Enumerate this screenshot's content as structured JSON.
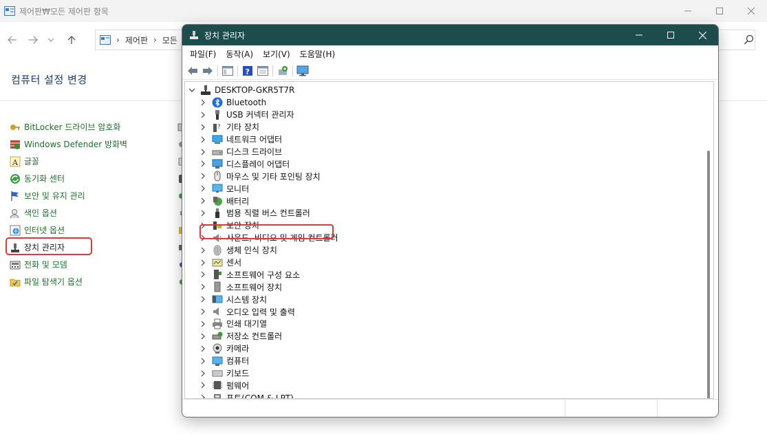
{
  "control_panel": {
    "window_title": "제어판₩모든 제어판 항목",
    "address": {
      "crumbs": [
        "제어판",
        "모든"
      ]
    },
    "heading": "컴퓨터 설정 변경",
    "items": [
      {
        "label": "BitLocker 드라이브 암호화",
        "icon": "bitlocker-icon"
      },
      {
        "label": "Windows Defender 방화벽",
        "icon": "firewall-icon"
      },
      {
        "label": "글꼴",
        "icon": "font-icon"
      },
      {
        "label": "동기화 센터",
        "icon": "sync-icon"
      },
      {
        "label": "보안 및 유지 관리",
        "icon": "flag-icon"
      },
      {
        "label": "색인 옵션",
        "icon": "index-icon"
      },
      {
        "label": "인터넷 옵션",
        "icon": "internet-icon"
      },
      {
        "label": "장치 관리자",
        "icon": "device-manager-icon"
      },
      {
        "label": "전화 및 모뎀",
        "icon": "phone-icon"
      },
      {
        "label": "파일 탐색기 옵션",
        "icon": "folder-icon"
      }
    ]
  },
  "device_manager": {
    "window_title": "장치 관리자",
    "menus": [
      "파일(F)",
      "동작(A)",
      "보기(V)",
      "도움말(H)"
    ],
    "root": "DESKTOP-GKR5T7R",
    "devices": [
      {
        "label": "Bluetooth",
        "icon": "bluetooth-icon"
      },
      {
        "label": "USB 커넥터 관리자",
        "icon": "usb-icon"
      },
      {
        "label": "기타 장치",
        "icon": "unknown-device-icon"
      },
      {
        "label": "네트워크 어댑터",
        "icon": "network-icon"
      },
      {
        "label": "디스크 드라이브",
        "icon": "disk-icon"
      },
      {
        "label": "디스플레이 어댑터",
        "icon": "display-adapter-icon"
      },
      {
        "label": "마우스 및 기타 포인팅 장치",
        "icon": "mouse-icon"
      },
      {
        "label": "모니터",
        "icon": "monitor-icon"
      },
      {
        "label": "배터리",
        "icon": "battery-icon"
      },
      {
        "label": "범용 직렬 버스 컨트롤러",
        "icon": "usb-controller-icon"
      },
      {
        "label": "보안 장치",
        "icon": "security-device-icon"
      },
      {
        "label": "사운드, 비디오 및 게임 컨트롤러",
        "icon": "sound-icon"
      },
      {
        "label": "생체 인식 장치",
        "icon": "biometric-icon"
      },
      {
        "label": "센서",
        "icon": "sensor-icon"
      },
      {
        "label": "소프트웨어 구성 요소",
        "icon": "software-component-icon"
      },
      {
        "label": "소프트웨어 장치",
        "icon": "software-device-icon"
      },
      {
        "label": "시스템 장치",
        "icon": "system-device-icon"
      },
      {
        "label": "오디오 입력 및 출력",
        "icon": "audio-io-icon"
      },
      {
        "label": "인쇄 대기열",
        "icon": "printer-icon"
      },
      {
        "label": "저장소 컨트롤러",
        "icon": "storage-controller-icon"
      },
      {
        "label": "카메라",
        "icon": "camera-icon"
      },
      {
        "label": "컴퓨터",
        "icon": "computer-icon"
      },
      {
        "label": "키보드",
        "icon": "keyboard-icon"
      },
      {
        "label": "펌웨어",
        "icon": "firmware-icon"
      },
      {
        "label": "포트(COM & LPT)",
        "icon": "port-icon"
      }
    ],
    "highlighted_device": "마우스 및 기타 포인팅 장치"
  },
  "colors": {
    "highlight_border": "#d83b3b",
    "dm_titlebar": "#1c4d4c",
    "cp_link": "#1f6e2b",
    "cp_heading": "#1c3a6e"
  }
}
